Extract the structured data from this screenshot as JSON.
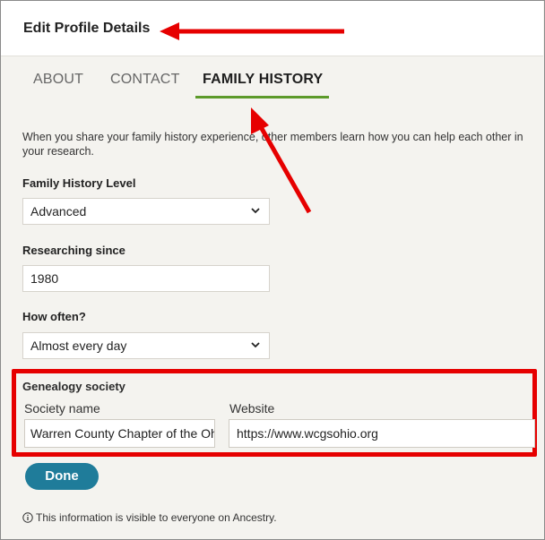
{
  "header": {
    "title": "Edit Profile Details"
  },
  "tabs": [
    {
      "label": "ABOUT"
    },
    {
      "label": "CONTACT"
    },
    {
      "label": "FAMILY HISTORY",
      "active": true
    }
  ],
  "intro_text": "When you share your family history experience, other members learn how you can help each other in your research.",
  "fields": {
    "level": {
      "label": "Family History Level",
      "value": "Advanced"
    },
    "since": {
      "label": "Researching since",
      "value": "1980"
    },
    "often": {
      "label": "How often?",
      "value": "Almost every day"
    }
  },
  "society": {
    "title": "Genealogy society",
    "name_label": "Society name",
    "name_value": "Warren County Chapter of the Ohio Genealogical Society",
    "website_label": "Website",
    "website_value": "https://www.wcgsohio.org"
  },
  "done_label": "Done",
  "info_text": "This information is visible to everyone on Ancestry.",
  "colors": {
    "accent_underline": "#5c9a2a",
    "button": "#1f7c9a",
    "annotation_red": "#e60000"
  }
}
